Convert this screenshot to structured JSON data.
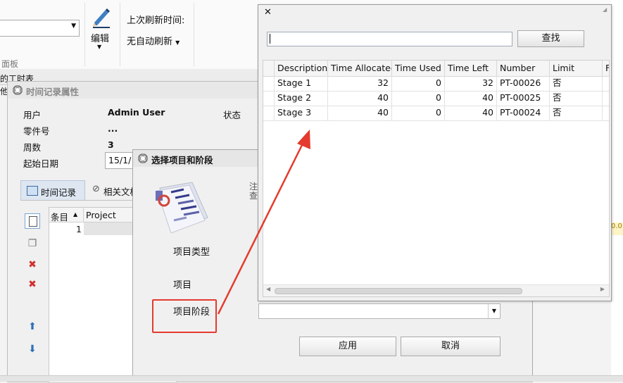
{
  "ribbon": {
    "edit_label": "编辑",
    "refresh_time_label": "上次刷新时间:",
    "auto_refresh_label": "无自动刷新",
    "panel_label": "面板"
  },
  "background": {
    "left_text_1": "的工时表",
    "left_text_2": "他",
    "right_value": "0.0"
  },
  "time_props": {
    "title": "时间记录属性",
    "fields": {
      "user_label": "用户",
      "user_value": "Admin User",
      "part_label": "零件号",
      "part_value": "...",
      "week_label": "周数",
      "week_value": "3",
      "start_label": "起始日期",
      "start_value": "15/1/",
      "status_label": "状态"
    },
    "tabs": {
      "time_records": "时间记录",
      "related_docs": "相关文档"
    },
    "grid": {
      "col_item": "条目",
      "col_project": "Project",
      "row_number": "1"
    }
  },
  "select_dialog": {
    "title": "选择项目和阶段",
    "note_line1": "注",
    "note_line2": "查",
    "project_type_label": "项目类型",
    "project_label": "项目",
    "project_phase_label": "项目阶段",
    "apply_label": "应用",
    "cancel_label": "取消"
  },
  "popup": {
    "close_glyph": "✕",
    "search_value": "",
    "find_label": "查找",
    "columns": [
      "Description",
      "Time Allocated",
      "Time Used",
      "Time Left",
      "Number",
      "Limit",
      "F"
    ],
    "rows": [
      {
        "description": "Stage 1",
        "time_allocated": "32",
        "time_used": "0",
        "time_left": "32",
        "number": "PT-00026",
        "limit": "否"
      },
      {
        "description": "Stage 2",
        "time_allocated": "40",
        "time_used": "0",
        "time_left": "40",
        "number": "PT-00025",
        "limit": "否"
      },
      {
        "description": "Stage 3",
        "time_allocated": "40",
        "time_used": "0",
        "time_left": "40",
        "number": "PT-00024",
        "limit": "否"
      }
    ]
  },
  "colors": {
    "annotation_red": "#e53a2e",
    "icon_blue": "#2f6fb8"
  }
}
